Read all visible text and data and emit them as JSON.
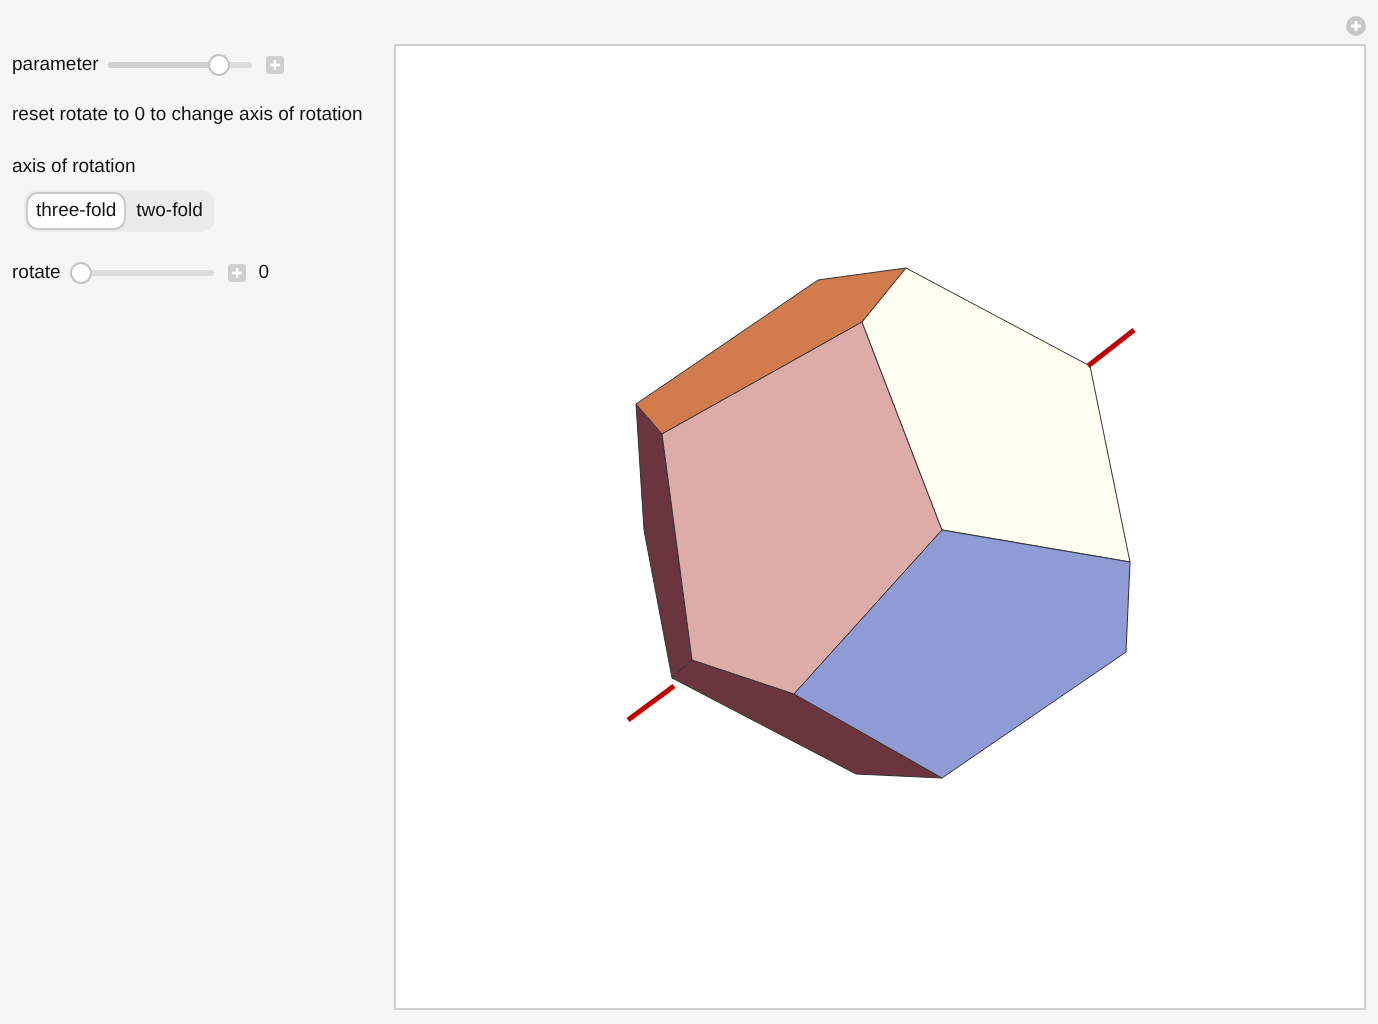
{
  "controls": {
    "parameter": {
      "label": "parameter",
      "level": 0.82
    },
    "note": "reset rotate to 0 to change axis of rotation",
    "axis": {
      "label": "axis of rotation",
      "options": [
        {
          "label": "three-fold",
          "selected": true
        },
        {
          "label": "two-fold",
          "selected": false
        }
      ]
    },
    "rotate": {
      "label": "rotate",
      "level": 0,
      "reading": "0"
    }
  }
}
